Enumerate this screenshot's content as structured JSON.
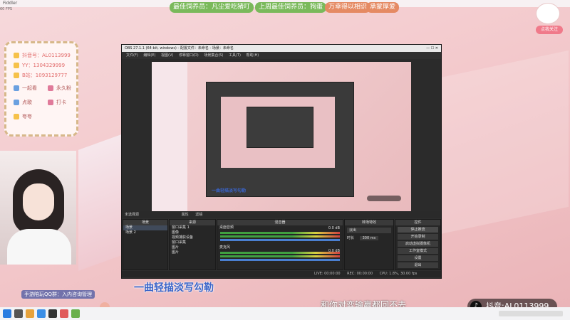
{
  "top_bar": {
    "app_label": "Fiddler",
    "fps": "60 FPS"
  },
  "banners": [
    {
      "text": "最佳饲养员：凡尘爱吃猪叮",
      "color": "#7ab95b"
    },
    {
      "text": "上周最佳饲养员：狗蛋",
      "color": "#7ab95b"
    },
    {
      "text": "万幸得以相识",
      "color": "#e58a63"
    },
    {
      "text": "承蒙厚爱",
      "color": "#e58a63"
    }
  ],
  "follow_button": "点我关注",
  "info_card": {
    "rows": [
      {
        "label": "抖音号：AL0113999"
      },
      {
        "label": "YY：1304329999"
      },
      {
        "label": "B站：1093129777"
      },
      {
        "label": "一起看"
      },
      {
        "label": "永久粉"
      },
      {
        "label": "点歌"
      },
      {
        "label": "打卡"
      },
      {
        "label": "夸夸"
      }
    ]
  },
  "obs": {
    "title": "OBS 27.1.1 (64-bit, windows) - 配置文件：未命名 - 场景：未命名",
    "menu": [
      "文件(F)",
      "编辑(E)",
      "视图(V)",
      "停靠窗口(D)",
      "场景集合(S)",
      "工具(T)",
      "帮助(H)"
    ],
    "source_bar": "未选择源",
    "props_label": "属性",
    "filters_label": "滤镜",
    "panels": {
      "scenes": {
        "header": "场景",
        "items": [
          "场景",
          "场景 2"
        ]
      },
      "sources": {
        "header": "来源",
        "items": [
          "窗口采集 1",
          "图像",
          "视频捕获设备",
          "窗口采集",
          "图片",
          "图片"
        ]
      },
      "mixer": {
        "header": "混音器",
        "tracks": [
          {
            "name": "桌面音频",
            "db": "0.0 dB"
          },
          {
            "name": "麦克风",
            "db": "0.0 dB"
          }
        ]
      },
      "transitions": {
        "header": "转场特效",
        "type": "淡出",
        "duration_label": "时长",
        "duration": "300 ms"
      },
      "controls": {
        "header": "控件",
        "buttons": [
          "停止推流",
          "开始录制",
          "启动虚拟摄像机",
          "工作室模式",
          "设置",
          "退出"
        ]
      }
    },
    "status": {
      "live": "LIVE: 00:00:00",
      "rec": "REC: 00:00:00",
      "cpu": "CPU: 1.8%, 30.00 fps"
    }
  },
  "lyric_left": "一曲轻描淡写勾勒",
  "lyric_right": "和你对弈输赢都回不去",
  "bottom_left_text": "手游陪玩QQ群：入内咨询管理",
  "preview_lyric": "一曲轻描淡写勾勒",
  "tiktok": {
    "label": "抖音:AL0113999"
  }
}
